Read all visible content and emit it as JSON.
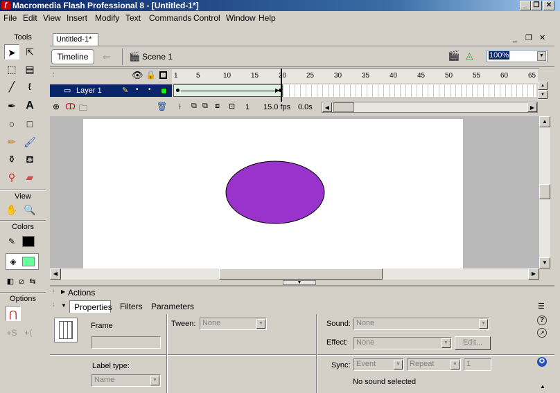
{
  "window": {
    "title": "Macromedia Flash Professional 8 - [Untitled-1*]",
    "minimize": "_",
    "restore": "❐",
    "close": "✕"
  },
  "menu": [
    "File",
    "Edit",
    "View",
    "Insert",
    "Modify",
    "Text",
    "Commands",
    "Control",
    "Window",
    "Help"
  ],
  "tools": {
    "heading": "Tools",
    "view_heading": "View",
    "colors_heading": "Colors",
    "options_heading": "Options",
    "stroke_color": "#000000",
    "fill_color": "#66ff99"
  },
  "document": {
    "tab": "Untitled-1*",
    "timeline_button": "Timeline",
    "scene": "Scene 1",
    "zoom": "100%"
  },
  "timeline": {
    "ruler": [
      "1",
      "5",
      "10",
      "15",
      "20",
      "25",
      "30",
      "35",
      "40",
      "45",
      "50",
      "55",
      "60",
      "65"
    ],
    "layer_name": "Layer 1",
    "current_frame": "1",
    "fps": "15.0 fps",
    "elapsed": "0.0s"
  },
  "stage": {
    "shape_fill": "#9933cc",
    "shape_stroke": "#000000"
  },
  "panels": {
    "actions": "Actions",
    "tabs": [
      "Properties",
      "Filters",
      "Parameters"
    ]
  },
  "properties": {
    "frame_label": "Frame",
    "frame_value": "",
    "label_type_label": "Label type:",
    "label_type_value": "Name",
    "tween_label": "Tween:",
    "tween_value": "None",
    "sound_label": "Sound:",
    "sound_value": "None",
    "effect_label": "Effect:",
    "effect_value": "None",
    "edit_button": "Edit...",
    "sync_label": "Sync:",
    "sync_value": "Event",
    "repeat_value": "Repeat",
    "repeat_count": "1",
    "no_sound": "No sound selected"
  }
}
